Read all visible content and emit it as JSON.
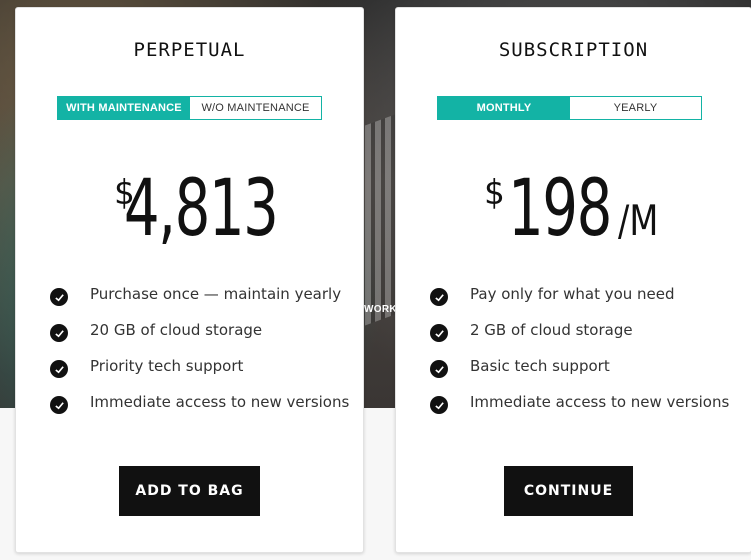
{
  "hero": {
    "peek_text": "WORK"
  },
  "cards": [
    {
      "title": "PERPETUAL",
      "toggle": [
        {
          "label": "WITH MAINTENANCE",
          "active": true
        },
        {
          "label": "W/O MAINTENANCE",
          "active": false
        }
      ],
      "price": {
        "currency": "$",
        "amount": "4,813",
        "period": ""
      },
      "features": [
        "Purchase once — maintain yearly",
        "20 GB of cloud storage",
        "Priority tech support",
        "Immediate access to new versions"
      ],
      "cta_label": "ADD TO BAG"
    },
    {
      "title": "SUBSCRIPTION",
      "toggle": [
        {
          "label": "MONTHLY",
          "active": true
        },
        {
          "label": "YEARLY",
          "active": false
        }
      ],
      "price": {
        "currency": "$",
        "amount": "198",
        "period": "/M"
      },
      "features": [
        "Pay only for what you need",
        "2 GB of cloud storage",
        "Basic tech support",
        "Immediate access to new versions"
      ],
      "cta_label": "CONTINUE"
    }
  ],
  "colors": {
    "accent": "#13b3a5",
    "cta_bg": "#111111",
    "text": "#333333"
  },
  "icons": {
    "feature_bullet": "check-circle-icon"
  }
}
